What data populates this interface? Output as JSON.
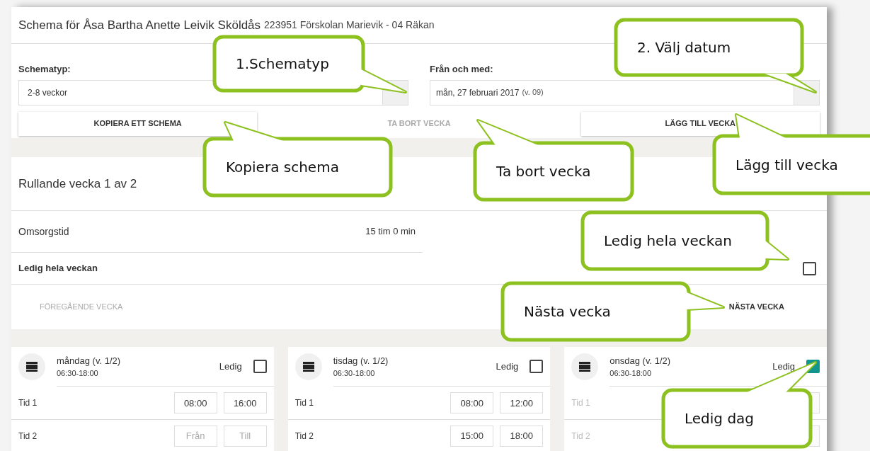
{
  "header": {
    "title": "Schema för Åsa Bartha Anette Leivik Sköldås",
    "subtitle": "223951 Förskolan Marievik - 04 Räkan"
  },
  "schematype": {
    "label": "Schematyp:",
    "value": "2-8 veckor"
  },
  "from_date": {
    "label": "Från och med:",
    "value": "mån, 27 februari 2017",
    "week": "(v. 09)"
  },
  "buttons": [
    {
      "label": "KOPIERA ETT SCHEMA",
      "disabled": false
    },
    {
      "label": "TA BORT VECKA",
      "disabled": true
    },
    {
      "label": "LÄGG TILL VECKA",
      "disabled": false
    }
  ],
  "week": {
    "title": "Rullande vecka 1 av 2",
    "care_time": {
      "label": "Omsorgstid",
      "value": "15 tim 0 min"
    },
    "week_off": {
      "label": "Ledig hela veckan",
      "checked": false
    }
  },
  "nav": {
    "previous": {
      "label": "FÖREGÅENDE VECKA",
      "disabled": true
    },
    "next": {
      "label": "NÄSTA VECKA",
      "disabled": false
    }
  },
  "days": [
    {
      "name": "måndag (v. 1/2)",
      "hours": "06:30-18:00",
      "off_label": "Ledig",
      "off": false,
      "times": [
        {
          "label": "Tid 1",
          "from": "08:00",
          "to": "16:00"
        },
        {
          "label": "Tid 2",
          "from_placeholder": "Från",
          "to_placeholder": "Till"
        }
      ]
    },
    {
      "name": "tisdag (v. 1/2)",
      "hours": "06:30-18:00",
      "off_label": "Ledig",
      "off": false,
      "times": [
        {
          "label": "Tid 1",
          "from": "08:00",
          "to": "12:00"
        },
        {
          "label": "Tid 2",
          "from": "15:00",
          "to": "18:00"
        }
      ]
    },
    {
      "name": "onsdag (v. 1/2)",
      "hours": "06:30-18:00",
      "off_label": "Ledig",
      "off": true,
      "times": [
        {
          "label": "Tid 1"
        },
        {
          "label": "Tid 2"
        }
      ]
    }
  ],
  "callouts": [
    {
      "text": "1.Schematyp"
    },
    {
      "text": "2. Välj datum"
    },
    {
      "text": "Kopiera schema"
    },
    {
      "text": "Ta bort vecka"
    },
    {
      "text": "Lägg till vecka"
    },
    {
      "text": "Ledig hela veckan"
    },
    {
      "text": "Nästa vecka"
    },
    {
      "text": "Ledig dag"
    }
  ]
}
